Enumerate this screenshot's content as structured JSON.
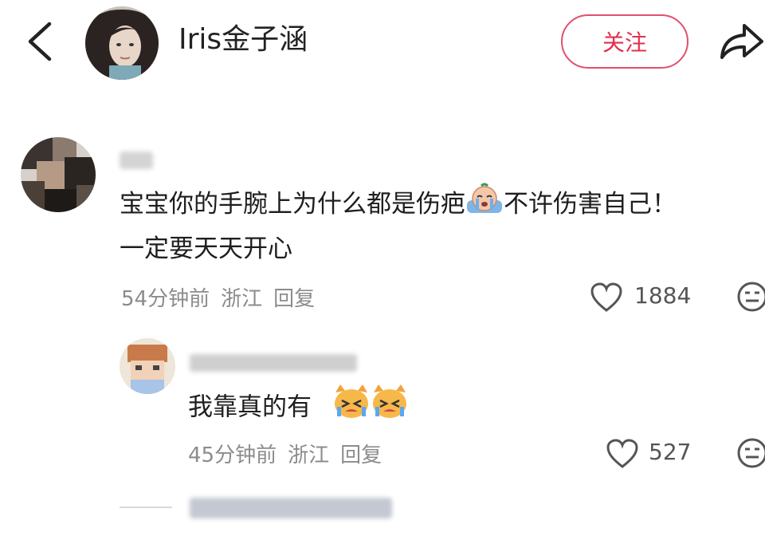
{
  "header": {
    "username": "Iris金子涵",
    "follow_label": "关注",
    "icons": {
      "back": "back-arrow-icon",
      "share": "share-arrow-icon"
    }
  },
  "comments": [
    {
      "text_line1": "宝宝你的手腕上为什么都是伤疤",
      "text_line1_after_emoji": "不许伤害自己！",
      "text_line2": "一定要天天开心",
      "emoji": "crying-face-icon",
      "time": "54分钟前",
      "location": "浙江",
      "reply_label": "回复",
      "likes": "1884"
    },
    {
      "text": "我靠真的有",
      "emoji": "crying-cat-icon",
      "time": "45分钟前",
      "location": "浙江",
      "reply_label": "回复",
      "likes": "527"
    }
  ],
  "colors": {
    "accent": "#e2304f",
    "meta": "#8c8c8c"
  }
}
